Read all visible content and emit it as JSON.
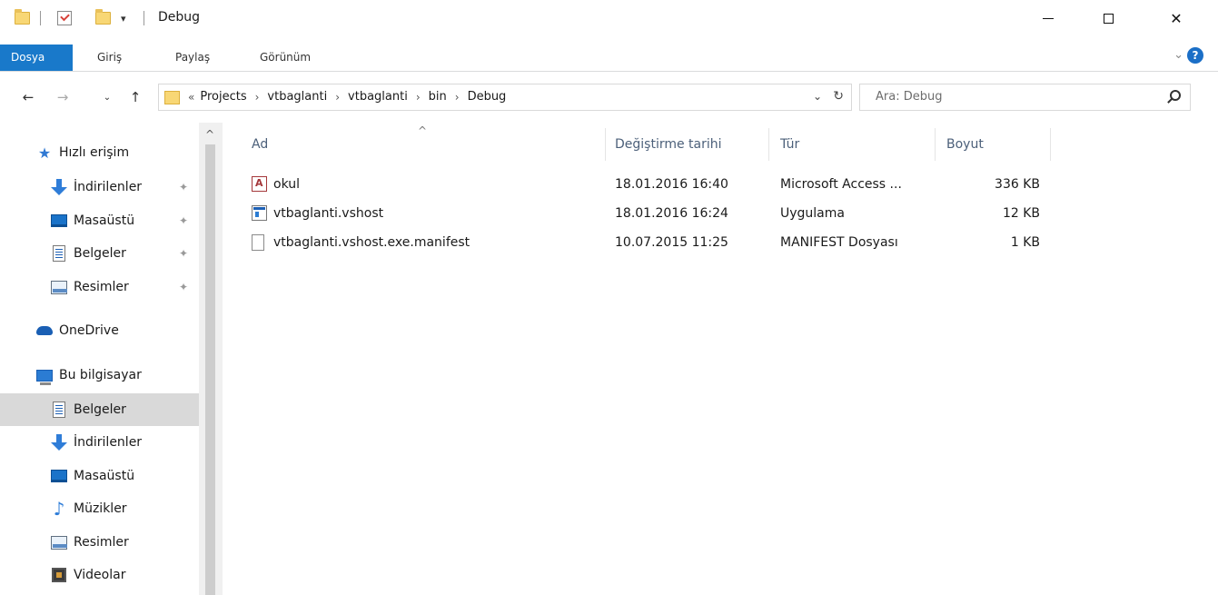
{
  "window": {
    "title": "Debug",
    "quick_access_arrow": "▾"
  },
  "ribbon": {
    "tabs": [
      {
        "label": "Dosya"
      },
      {
        "label": "Giriş"
      },
      {
        "label": "Paylaş"
      },
      {
        "label": "Görünüm"
      }
    ],
    "help": "?"
  },
  "address": {
    "prefix": "«",
    "crumbs": [
      "Projects",
      "vtbaglanti",
      "vtbaglanti",
      "bin",
      "Debug"
    ]
  },
  "search": {
    "placeholder": "Ara: Debug"
  },
  "nav": {
    "items": [
      {
        "label": "Hızlı erişim",
        "icon": "star-icon"
      },
      {
        "label": "İndirilenler",
        "icon": "download-icon",
        "pinned": true
      },
      {
        "label": "Masaüstü",
        "icon": "desktop-icon",
        "pinned": true
      },
      {
        "label": "Belgeler",
        "icon": "documents-icon",
        "pinned": true
      },
      {
        "label": "Resimler",
        "icon": "pictures-icon",
        "pinned": true
      },
      {
        "label": "OneDrive",
        "icon": "onedrive-icon"
      },
      {
        "label": "Bu bilgisayar",
        "icon": "this-pc-icon"
      },
      {
        "label": "Belgeler",
        "icon": "documents-icon",
        "selected": true
      },
      {
        "label": "İndirilenler",
        "icon": "download-icon"
      },
      {
        "label": "Masaüstü",
        "icon": "desktop-icon"
      },
      {
        "label": "Müzikler",
        "icon": "music-icon"
      },
      {
        "label": "Resimler",
        "icon": "pictures-icon"
      },
      {
        "label": "Videolar",
        "icon": "videos-icon"
      }
    ]
  },
  "columns": {
    "name": "Ad",
    "date": "Değiştirme tarihi",
    "type": "Tür",
    "size": "Boyut"
  },
  "files": [
    {
      "name": "okul",
      "date": "18.01.2016 16:40",
      "type": "Microsoft Access ...",
      "size": "336 KB",
      "icon": "access-db-icon"
    },
    {
      "name": "vtbaglanti.vshost",
      "date": "18.01.2016 16:24",
      "type": "Uygulama",
      "size": "12 KB",
      "icon": "application-icon"
    },
    {
      "name": "vtbaglanti.vshost.exe.manifest",
      "date": "10.07.2015 11:25",
      "type": "MANIFEST Dosyası",
      "size": "1 KB",
      "icon": "blank-file-icon"
    }
  ]
}
